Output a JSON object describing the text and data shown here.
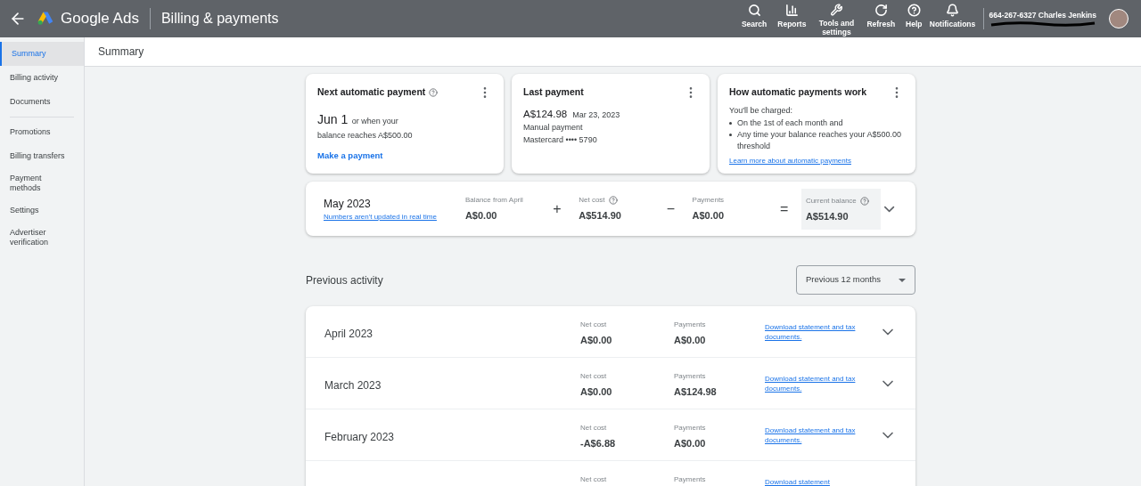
{
  "header": {
    "product": "Google Ads",
    "page_title": "Billing & payments",
    "tools": [
      {
        "kind": "search",
        "label": "Search"
      },
      {
        "kind": "reports",
        "label": "Reports"
      },
      {
        "kind": "tools",
        "label": "Tools and settings"
      },
      {
        "kind": "refresh",
        "label": "Refresh"
      },
      {
        "kind": "help",
        "label": "Help"
      },
      {
        "kind": "notifications",
        "label": "Notifications"
      }
    ],
    "account": "664-267-6327 Charles Jenkins"
  },
  "sidebar": {
    "groups": [
      [
        {
          "label": "Summary",
          "selected": true
        },
        {
          "label": "Billing activity",
          "selected": false
        },
        {
          "label": "Documents",
          "selected": false
        }
      ],
      [
        {
          "label": "Promotions",
          "selected": false
        },
        {
          "label": "Billing transfers",
          "selected": false
        },
        {
          "label": "Payment methods",
          "selected": false
        },
        {
          "label": "Settings",
          "selected": false
        },
        {
          "label": "Advertiser verification",
          "selected": false
        }
      ]
    ]
  },
  "page_heading": "Summary",
  "next_payment": {
    "title": "Next automatic payment",
    "date": "Jun 1",
    "date_note": "or when your",
    "condition": "balance reaches A$500.00",
    "action": "Make a payment"
  },
  "last_payment": {
    "title": "Last payment",
    "amount": "A$124.98",
    "date": "Mar 23, 2023",
    "type": "Manual payment",
    "method": "Mastercard •••• 5790"
  },
  "how_it_works": {
    "title": "How automatic payments work",
    "intro": "You'll be charged:",
    "bullets": [
      "On the 1st of each month and",
      "Any time your balance reaches your A$500.00 threshold"
    ],
    "link": "Learn more about automatic payments"
  },
  "current_month": {
    "month": "May 2023",
    "note": "Numbers aren't updated in real time",
    "terms": [
      {
        "label": "Balance from April",
        "value": "A$0.00",
        "help": false,
        "op": "+"
      },
      {
        "label": "Net cost",
        "value": "A$514.90",
        "help": true,
        "op": "−"
      },
      {
        "label": "Payments",
        "value": "A$0.00",
        "help": false,
        "op": "="
      }
    ],
    "current_balance": {
      "label": "Current balance",
      "value": "A$514.90",
      "help": true
    }
  },
  "previous_activity": {
    "title": "Previous activity",
    "range": "Previous 12 months",
    "rows": [
      {
        "month": "April 2023",
        "net_cost_label": "Net cost",
        "net_cost": "A$0.00",
        "payments_label": "Payments",
        "payments": "A$0.00",
        "link": "Download statement and tax documents."
      },
      {
        "month": "March 2023",
        "net_cost_label": "Net cost",
        "net_cost": "A$0.00",
        "payments_label": "Payments",
        "payments": "A$124.98",
        "link": "Download statement and tax documents."
      },
      {
        "month": "February 2023",
        "net_cost_label": "Net cost",
        "net_cost": "-A$6.88",
        "payments_label": "Payments",
        "payments": "A$0.00",
        "link": "Download statement and tax documents."
      },
      {
        "net_cost_label": "Net cost",
        "payments_label": "Payments",
        "link": "Download statement"
      }
    ]
  }
}
